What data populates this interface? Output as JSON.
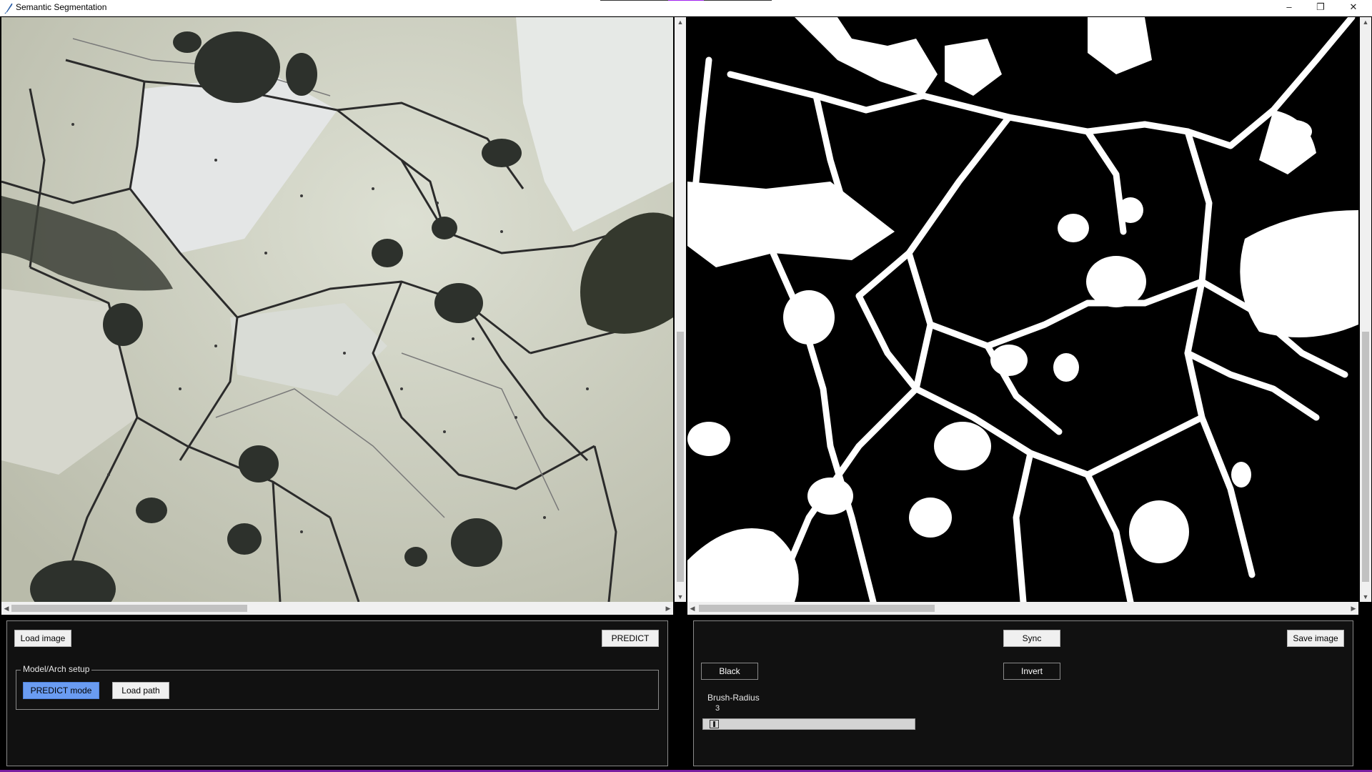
{
  "window": {
    "title": "Semantic Segmentation",
    "controls": {
      "minimize": "–",
      "maximize": "❐",
      "close": "✕"
    }
  },
  "left_panel": {
    "load_image_label": "Load image",
    "predict_label": "PREDICT",
    "group_title": "Model/Arch setup",
    "predict_mode_label": "PREDICT mode",
    "load_path_label": "Load path"
  },
  "right_panel": {
    "sync_label": "Sync",
    "save_image_label": "Save image",
    "black_label": "Black",
    "invert_label": "Invert",
    "brush_radius_label": "Brush-Radius",
    "brush_radius_value": "3"
  },
  "icons": {
    "app": "feather-icon",
    "scroll_up": "▲",
    "scroll_down": "▼",
    "scroll_left": "◀",
    "scroll_right": "▶"
  },
  "colors": {
    "panel_bg": "#111111",
    "predict_mode_active": "#6a9cf2",
    "mask_foreground": "#ffffff",
    "mask_background": "#000000"
  }
}
